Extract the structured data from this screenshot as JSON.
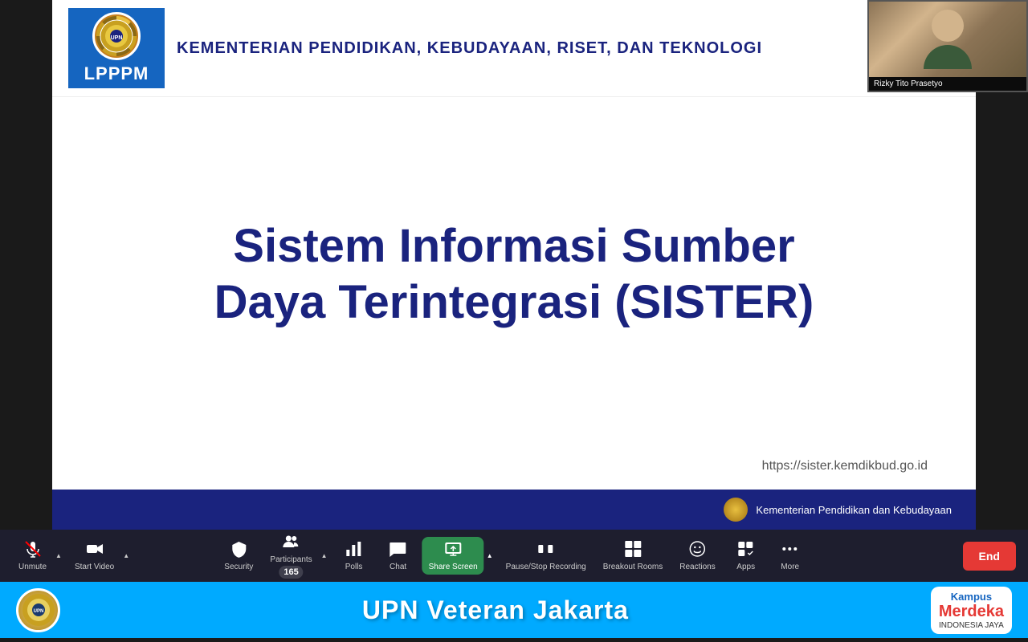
{
  "slide": {
    "logo_text": "LPPPM",
    "ministry_text": "KEMENTERIAN PENDIDIKAN, KEBUDAYAAN, RISET, DAN TEKNOLOGI",
    "title_line1": "Sistem Informasi Sumber",
    "title_line2": "Daya Terintegrasi (SISTER)",
    "url": "https://sister.kemdikbud.go.id",
    "kemdikbud_label": "Kementerian Pendidikan dan Kebudayaan"
  },
  "participant": {
    "name": "Rizky Tito Prasetyo"
  },
  "toolbar": {
    "unmute_label": "Unmute",
    "start_video_label": "Start Video",
    "security_label": "Security",
    "participants_label": "Participants",
    "participants_count": "165",
    "polls_label": "Polls",
    "chat_label": "Chat",
    "share_screen_label": "Share Screen",
    "pause_recording_label": "Pause/Stop Recording",
    "breakout_rooms_label": "Breakout Rooms",
    "reactions_label": "Reactions",
    "apps_label": "Apps",
    "more_label": "More",
    "end_label": "End"
  },
  "bottom_banner": {
    "title": "UPN Veteran Jakarta",
    "kampus_label": "Kampus",
    "merdeka_label": "Merdeka",
    "indonesia_jaya": "INDONESIA JAYA"
  },
  "colors": {
    "toolbar_bg": "#1e1e2e",
    "share_screen_green": "#2d8c4e",
    "end_red": "#e53935",
    "banner_blue": "#00aaff",
    "title_navy": "#1a237e"
  }
}
